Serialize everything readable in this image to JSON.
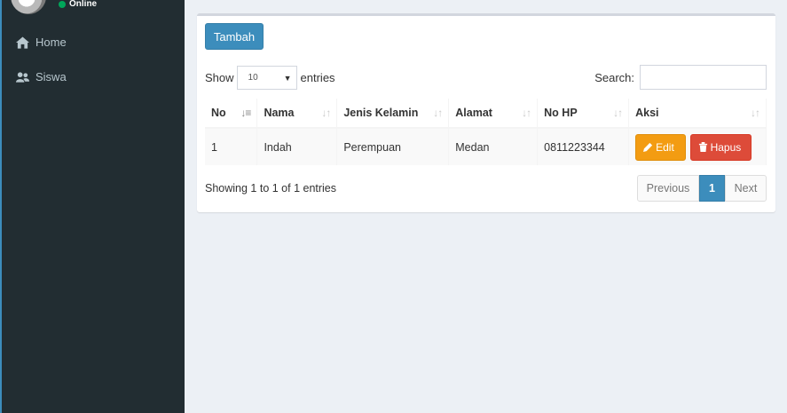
{
  "sidebar": {
    "user_status": "Online",
    "menu": [
      {
        "label": "Home",
        "icon": "home-icon"
      },
      {
        "label": "Siswa",
        "icon": "users-icon"
      }
    ]
  },
  "toolbar": {
    "add_label": "Tambah"
  },
  "table_controls": {
    "show_label": "Show",
    "page_length": "10",
    "entries_label": "entries",
    "search_label": "Search:",
    "search_value": ""
  },
  "table": {
    "columns": [
      "No",
      "Nama",
      "Jenis Kelamin",
      "Alamat",
      "No HP",
      "Aksi"
    ],
    "rows": [
      {
        "no": "1",
        "nama": "Indah",
        "jenis_kelamin": "Perempuan",
        "alamat": "Medan",
        "no_hp": "0811223344"
      }
    ],
    "edit_label": "Edit",
    "delete_label": "Hapus"
  },
  "footer": {
    "info": "Showing 1 to 1 of 1 entries",
    "prev_label": "Previous",
    "current_page": "1",
    "next_label": "Next"
  },
  "colors": {
    "sidebar_bg": "#222d32",
    "primary": "#3c8dbc",
    "warning": "#f39c12",
    "danger": "#dd4b39",
    "online": "#00a65a"
  }
}
